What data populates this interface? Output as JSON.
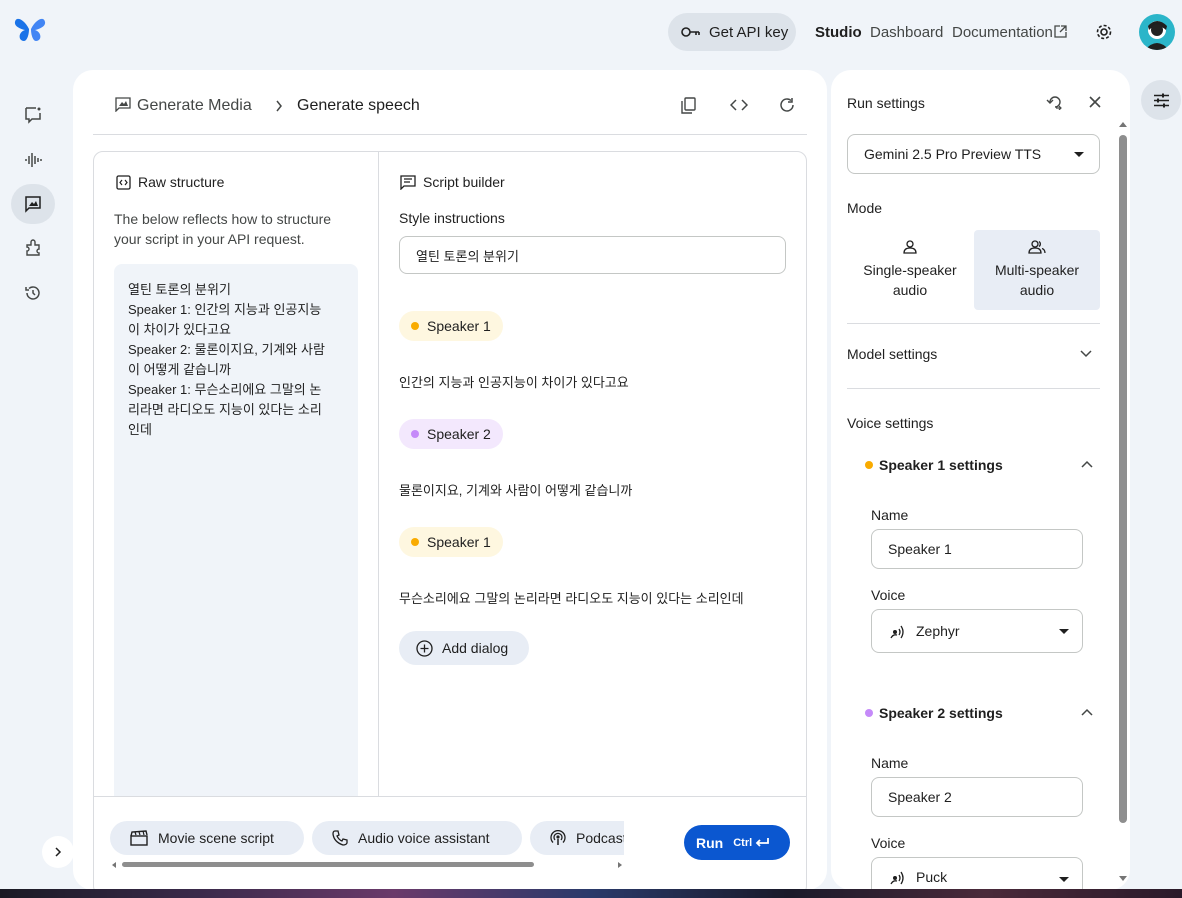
{
  "header": {
    "get_api_key": "Get API key",
    "nav": [
      "Studio",
      "Dashboard",
      "Documentation"
    ]
  },
  "breadcrumb": {
    "parent": "Generate Media",
    "current": "Generate speech"
  },
  "raw_structure": {
    "title": "Raw structure",
    "description": [
      "The below reflects how to structure",
      "your script in your API request."
    ],
    "lines": [
      "열틴 토론의 분위기",
      "Speaker 1: 인간의 지능과 인공지능",
      "이 차이가 있다고요",
      "Speaker 2: 물론이지요, 기계와 사람",
      "이 어떻게 같습니까",
      "Speaker 1: 무슨소리에요 그말의 논",
      "리라면 라디오도 지능이 있다는 소리",
      "인데"
    ]
  },
  "script_builder": {
    "title": "Script builder",
    "style_label": "Style instructions",
    "style_value": "열틴 토론의 분위기",
    "dialogs": [
      {
        "speaker": "Speaker 1",
        "text": "인간의 지능과 인공지능이 차이가 있다고요"
      },
      {
        "speaker": "Speaker 2",
        "text": "물론이지요, 기계와 사람이 어떻게 같습니까"
      },
      {
        "speaker": "Speaker 1",
        "text": "무슨소리에요 그말의 논리라면 라디오도 지능이 있다는 소리인데"
      }
    ],
    "add_dialog": "Add dialog"
  },
  "prompts": [
    "Movie scene script",
    "Audio voice assistant",
    "Podcast"
  ],
  "run": {
    "label": "Run",
    "shortcut": "Ctrl"
  },
  "run_settings": {
    "title": "Run settings",
    "model": "Gemini 2.5 Pro Preview TTS",
    "mode_label": "Mode",
    "modes": [
      {
        "line1": "Single-speaker",
        "line2": "audio"
      },
      {
        "line1": "Multi-speaker",
        "line2": "audio"
      }
    ],
    "model_settings": "Model settings",
    "voice_settings": "Voice settings",
    "speakers": [
      {
        "title": "Speaker 1 settings",
        "name_label": "Name",
        "name": "Speaker 1",
        "voice_label": "Voice",
        "voice": "Zephyr",
        "color": "#f9ab00"
      },
      {
        "title": "Speaker 2 settings",
        "name_label": "Name",
        "name": "Speaker 2",
        "voice_label": "Voice",
        "voice": "Puck",
        "color": "#c58af9"
      }
    ]
  },
  "colors": {
    "accent": "#0b57d0",
    "speaker1": "#f9ab00",
    "speaker2": "#c58af9"
  }
}
